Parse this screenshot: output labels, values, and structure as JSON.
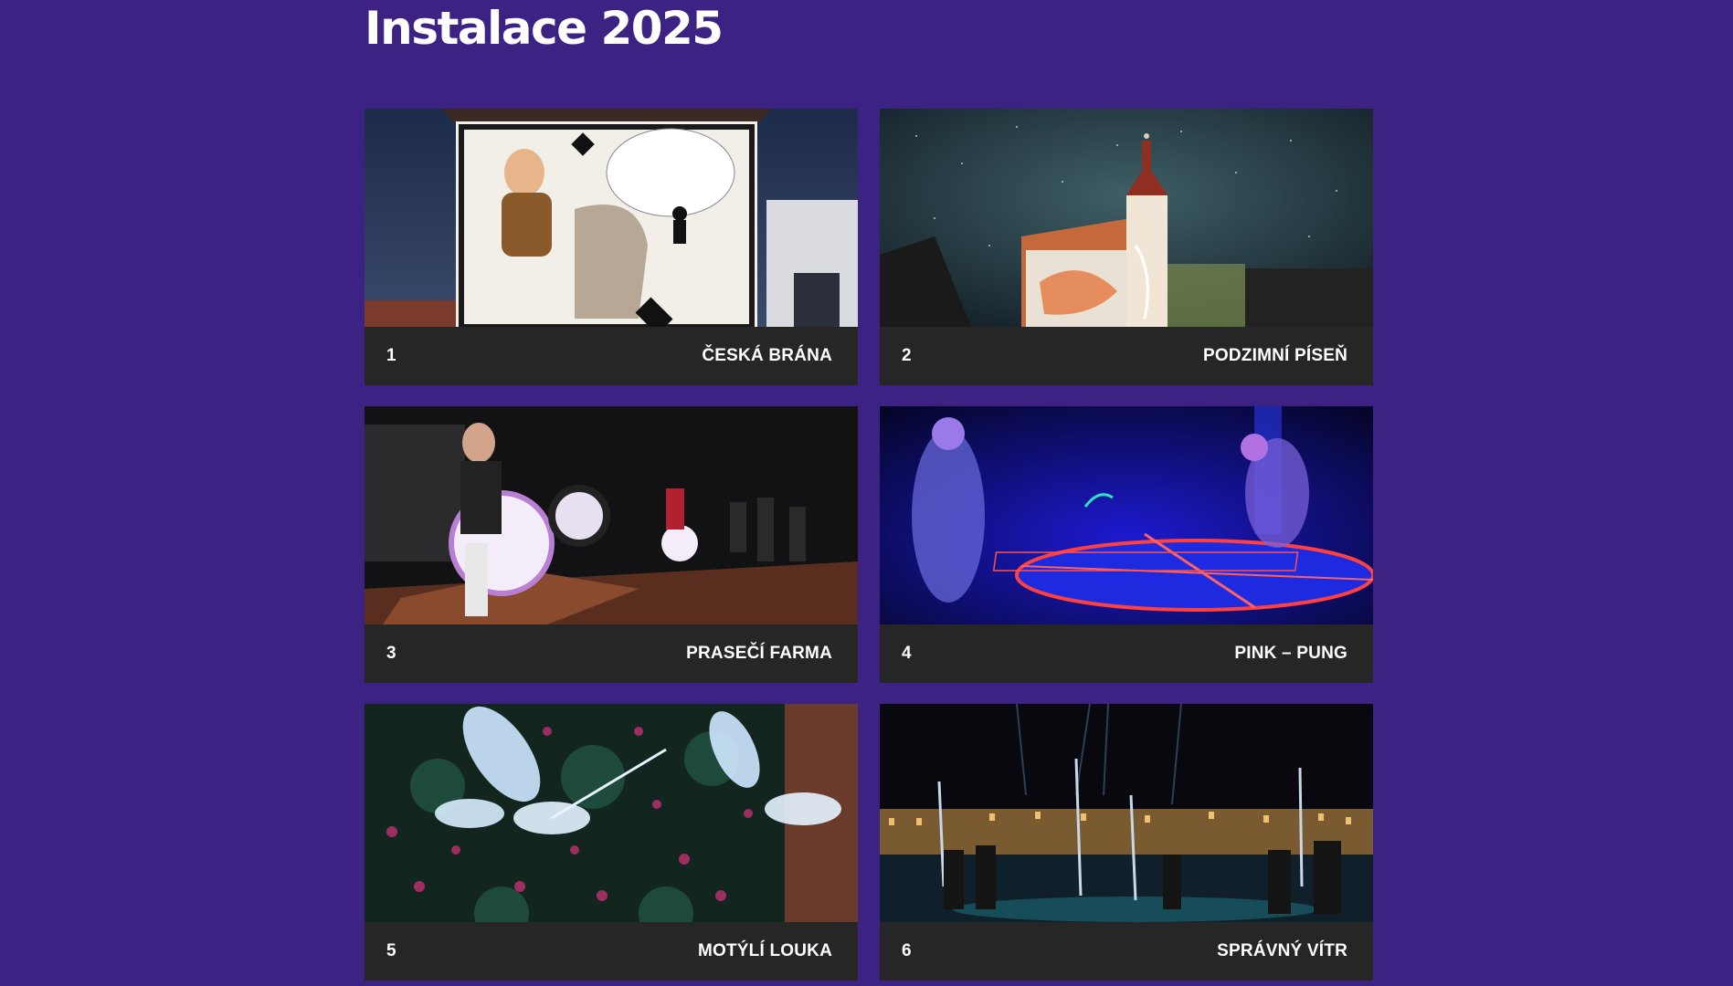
{
  "page": {
    "title": "Instalace 2025",
    "background_color": "#3b2283",
    "card_footer_color": "#262626"
  },
  "installations": [
    {
      "number": "1",
      "name": "ČESKÁ BRÁNA",
      "image": "mural-photo-chess-knight"
    },
    {
      "number": "2",
      "name": "PODZIMNÍ PÍSEŇ",
      "image": "castle-projection-photo"
    },
    {
      "number": "3",
      "name": "PRASEČÍ FARMA",
      "image": "glowing-pig-rides-photo"
    },
    {
      "number": "4",
      "name": "PINK – PUNG",
      "image": "neon-ping-pong-photo"
    },
    {
      "number": "5",
      "name": "MOTÝLÍ LOUKA",
      "image": "glowing-butterflies-photo"
    },
    {
      "number": "6",
      "name": "SPRÁVNÝ VÍTR",
      "image": "town-square-lights-photo"
    }
  ]
}
